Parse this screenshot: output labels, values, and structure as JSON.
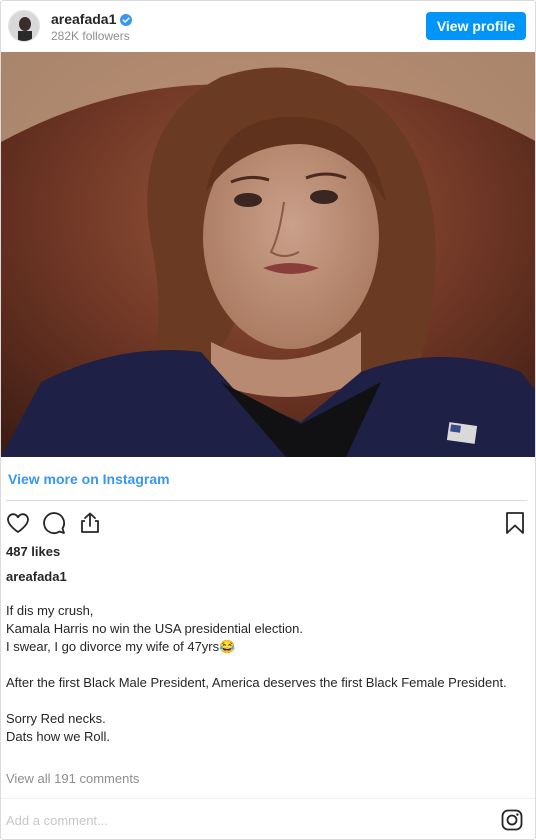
{
  "header": {
    "username": "areafada1",
    "followers": "282K followers",
    "view_profile_label": "View profile"
  },
  "post": {
    "view_more_label": "View more on Instagram",
    "likes": "487 likes",
    "caption_username": "areafada1",
    "caption_lines": [
      "If dis my crush,",
      "Kamala Harris no win the USA presidential election.",
      "I swear, I go divorce my wife of 47yrs😂",
      "After the first Black Male President, America deserves the first Black Female President.",
      "Sorry Red necks.",
      "Dats how we Roll."
    ],
    "view_comments_label": "View all 191 comments",
    "add_comment_placeholder": "Add a comment..."
  },
  "icons": {
    "verified": "verified-badge-icon",
    "like": "heart-icon",
    "comment": "comment-bubble-icon",
    "share": "share-icon",
    "save": "bookmark-icon",
    "instagram": "instagram-logo-icon"
  },
  "colors": {
    "accent": "#0095f6",
    "link": "#3897f0",
    "muted": "#8e8e8e"
  }
}
